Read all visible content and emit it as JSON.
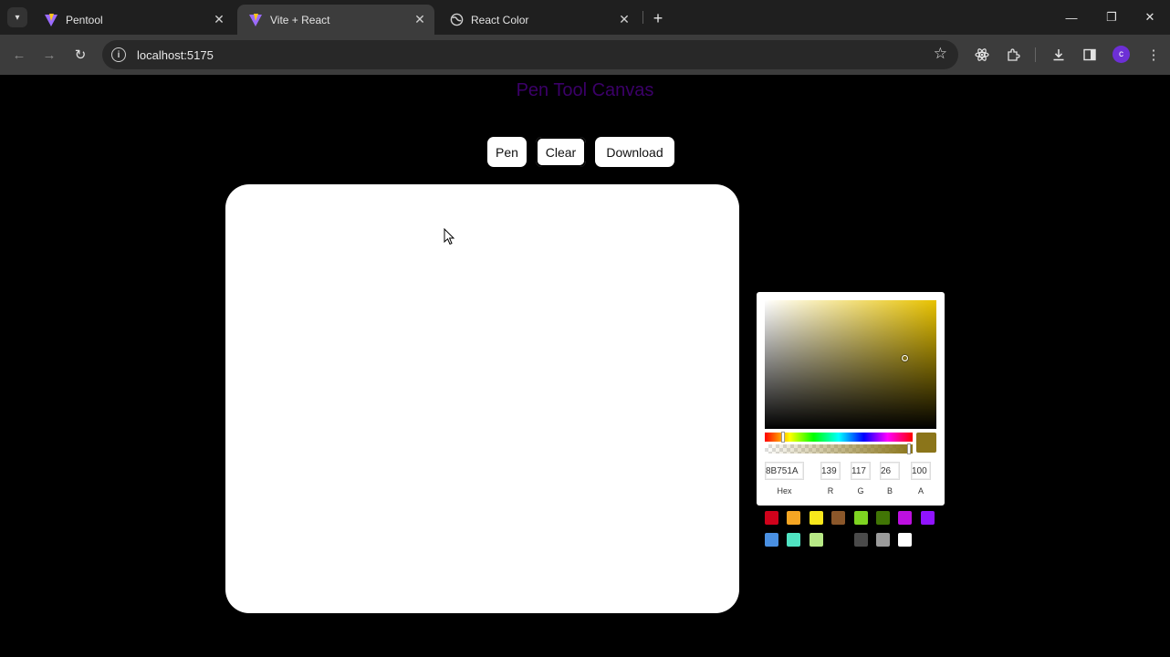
{
  "browser": {
    "tabs": [
      {
        "title": "Pentool",
        "active": false
      },
      {
        "title": "Vite + React",
        "active": true
      },
      {
        "title": "React Color",
        "active": false
      }
    ],
    "url": "localhost:5175",
    "profile_initial": "c"
  },
  "page": {
    "title": "Pen Tool Canvas",
    "buttons": {
      "pen": "Pen",
      "clear": "Clear",
      "download": "Download"
    }
  },
  "picker": {
    "selected_color": "#8B751A",
    "hue_color": "#e8c200",
    "hex": "8B751A",
    "r": "139",
    "g": "117",
    "b": "26",
    "a": "100",
    "labels": {
      "hex": "Hex",
      "r": "R",
      "g": "G",
      "b": "B",
      "a": "A"
    },
    "presets": [
      "#d0021b",
      "#f5a623",
      "#f8e71c",
      "#8b572a",
      "#7ed321",
      "#417505",
      "#bd10e0",
      "#9013fe",
      "#4a90e2",
      "#50e3c2",
      "#b8e986",
      "#000000",
      "#4a4a4a",
      "#9b9b9b",
      "#ffffff"
    ]
  }
}
